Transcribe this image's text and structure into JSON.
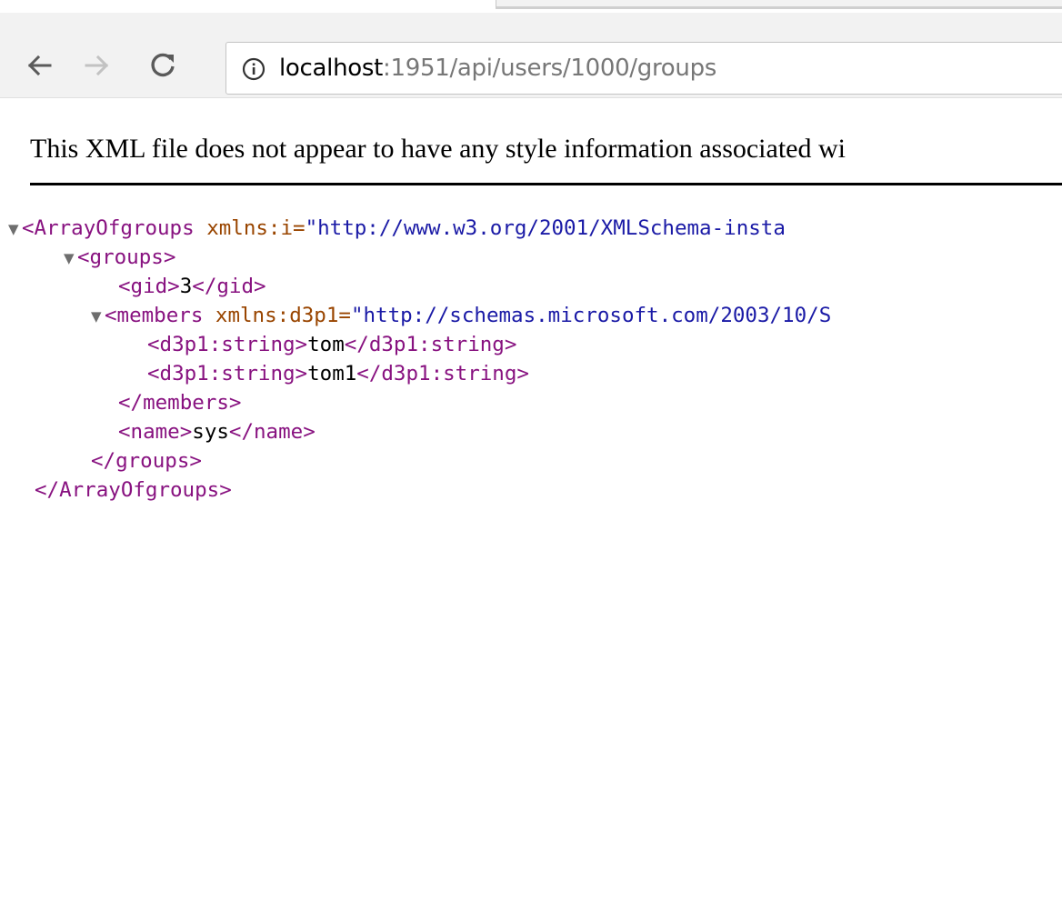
{
  "toolbar": {
    "back_icon": "arrow-left-icon",
    "forward_icon": "arrow-right-icon",
    "reload_icon": "reload-icon",
    "info_icon": "info-icon"
  },
  "address_bar": {
    "host": "localhost",
    "path": ":1951/api/users/1000/groups"
  },
  "page": {
    "notice": "This XML file does not appear to have any style information associated wi"
  },
  "xml": {
    "root_open_tag": "<ArrayOfgroups",
    "root_attr_name": " xmlns:i=",
    "root_attr_value": "\"http://www.w3.org/2001/XMLSchema-insta",
    "groups_open": "<groups>",
    "gid_open": "<gid>",
    "gid_value": "3",
    "gid_close": "</gid>",
    "members_open_tag": "<members",
    "members_attr_name": " xmlns:d3p1=",
    "members_attr_value": "\"http://schemas.microsoft.com/2003/10/S",
    "string_open": "<d3p1:string>",
    "member1": "tom",
    "string_close": "</d3p1:string>",
    "member2": "tom1",
    "members_close": "</members>",
    "name_open": "<name>",
    "name_value": "sys",
    "name_close": "</name>",
    "groups_close": "</groups>",
    "root_close": "</ArrayOfgroups>"
  },
  "colors": {
    "tag": "#881280",
    "attribute": "#994500",
    "value": "#1a1aa6"
  }
}
